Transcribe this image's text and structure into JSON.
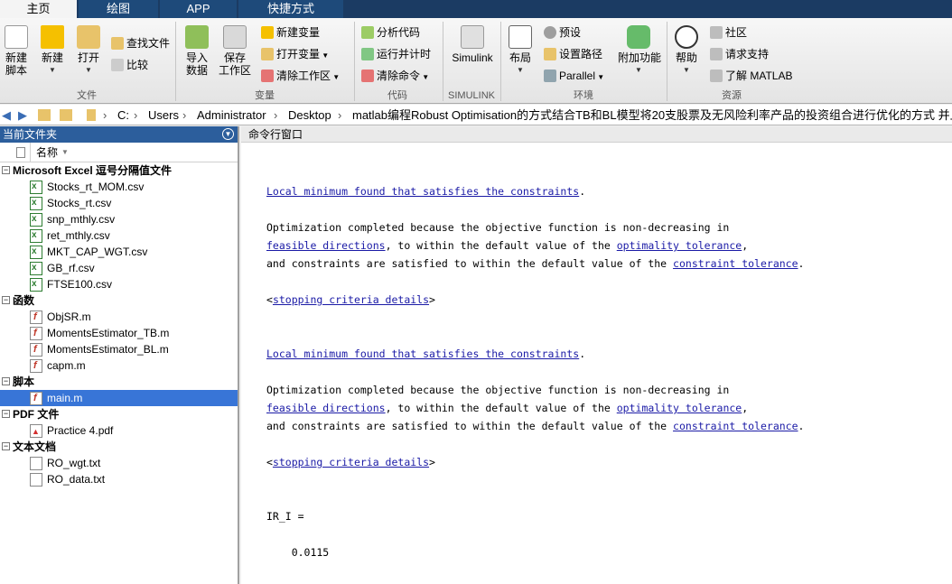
{
  "tabs": [
    "主页",
    "绘图",
    "APP",
    "快捷方式"
  ],
  "ribbon": {
    "file": {
      "new_script": "新建\n脚本",
      "new": "新建",
      "open": "打开",
      "find_files": "查找文件",
      "compare": "比较",
      "group": "文件"
    },
    "variable": {
      "import": "导入\n数据",
      "save_ws": "保存\n工作区",
      "new_var": "新建变量",
      "open_var": "打开变量",
      "clear_ws": "清除工作区",
      "group": "变量"
    },
    "code": {
      "analyze": "分析代码",
      "run_time": "运行并计时",
      "clear_cmd": "清除命令",
      "group": "代码"
    },
    "simulink": {
      "label": "Simulink",
      "group": "SIMULINK"
    },
    "env": {
      "layout": "布局",
      "prefs": "预设",
      "set_path": "设置路径",
      "parallel": "Parallel",
      "addons": "附加功能",
      "group": "环境"
    },
    "resources": {
      "help": "帮助",
      "community": "社区",
      "request_support": "请求支持",
      "learn": "了解 MATLAB",
      "group": "资源"
    }
  },
  "address": {
    "parts": [
      "C:",
      "Users",
      "Administrator",
      "Desktop",
      "matlab编程Robust Optimisation的方式结合TB和BL模型将20支股票及无风险利率产品的投资组合进行优化的方式 并且以夏普"
    ],
    "separator": "›"
  },
  "current_folder": {
    "title": "当前文件夹",
    "column": "名称",
    "groups": [
      {
        "name": "Microsoft Excel 逗号分隔值文件",
        "kind": "xls",
        "files": [
          "Stocks_rt_MOM.csv",
          "Stocks_rt.csv",
          "snp_mthly.csv",
          "ret_mthly.csv",
          "MKT_CAP_WGT.csv",
          "GB_rf.csv",
          "FTSE100.csv"
        ]
      },
      {
        "name": "函数",
        "kind": "mf",
        "files": [
          "ObjSR.m",
          "MomentsEstimator_TB.m",
          "MomentsEstimator_BL.m",
          "capm.m"
        ]
      },
      {
        "name": "脚本",
        "kind": "mf",
        "files": [
          "main.m"
        ]
      },
      {
        "name": "PDF 文件",
        "kind": "pdf",
        "files": [
          "Practice 4.pdf"
        ]
      },
      {
        "name": "文本文档",
        "kind": "txt",
        "files": [
          "RO_wgt.txt",
          "RO_data.txt"
        ]
      }
    ],
    "selected": "main.m"
  },
  "command_window": {
    "title": "命令行窗口",
    "lines": [
      {
        "t": "link",
        "text": "Local minimum found that satisfies the constraints",
        "suffix": "."
      },
      {
        "t": "text",
        "text": "Optimization completed because the objective function is non-decreasing in"
      },
      {
        "t": "mixed",
        "parts": [
          [
            "feasible directions",
            true
          ],
          [
            ", to within the default value of the ",
            false
          ],
          [
            "optimality tolerance",
            true
          ],
          [
            ",",
            false
          ]
        ]
      },
      {
        "t": "mixed",
        "parts": [
          [
            "and constraints are satisfied to within the default value of the ",
            false
          ],
          [
            "constraint tolerance",
            true
          ],
          [
            ".",
            false
          ]
        ]
      },
      {
        "t": "mixed",
        "parts": [
          [
            "<",
            false
          ],
          [
            "stopping criteria details",
            true
          ],
          [
            ">",
            false
          ]
        ]
      },
      {
        "t": "link",
        "text": "Local minimum found that satisfies the constraints",
        "suffix": "."
      },
      {
        "t": "text",
        "text": "Optimization completed because the objective function is non-decreasing in"
      },
      {
        "t": "mixed",
        "parts": [
          [
            "feasible directions",
            true
          ],
          [
            ", to within the default value of the ",
            false
          ],
          [
            "optimality tolerance",
            true
          ],
          [
            ",",
            false
          ]
        ]
      },
      {
        "t": "mixed",
        "parts": [
          [
            "and constraints are satisfied to within the default value of the ",
            false
          ],
          [
            "constraint tolerance",
            true
          ],
          [
            ".",
            false
          ]
        ]
      },
      {
        "t": "mixed",
        "parts": [
          [
            "<",
            false
          ],
          [
            "stopping criteria details",
            true
          ],
          [
            ">",
            false
          ]
        ]
      },
      {
        "t": "text",
        "text": "IR_I ="
      },
      {
        "t": "text",
        "text": "    0.0115"
      }
    ]
  }
}
